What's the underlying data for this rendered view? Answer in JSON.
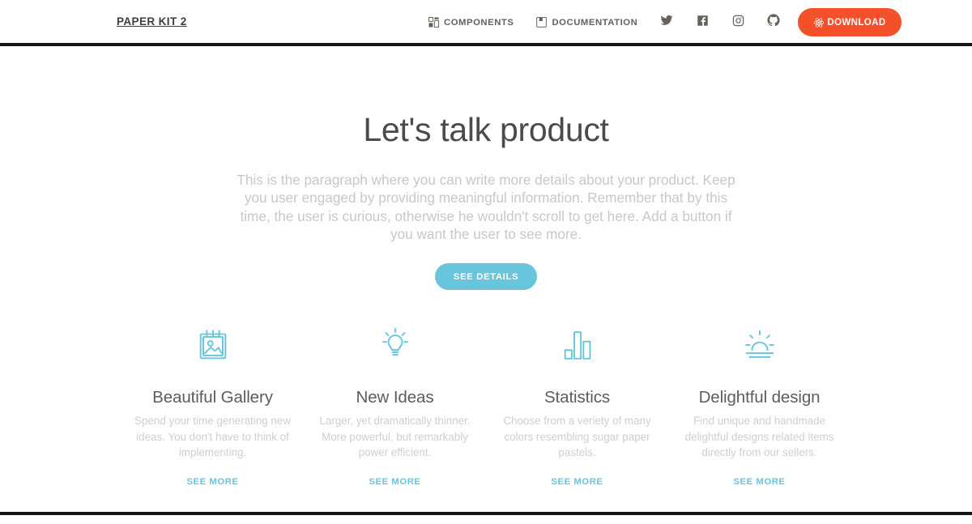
{
  "navbar": {
    "brand": "PAPER KIT 2",
    "links": [
      {
        "label": "COMPONENTS",
        "icon": "components-icon"
      },
      {
        "label": "DOCUMENTATION",
        "icon": "documentation-icon"
      }
    ],
    "socials": [
      {
        "name": "twitter-icon",
        "title": "Twitter"
      },
      {
        "name": "facebook-icon",
        "title": "Facebook"
      },
      {
        "name": "instagram-icon",
        "title": "Instagram"
      },
      {
        "name": "github-icon",
        "title": "GitHub"
      }
    ],
    "download_label": "DOWNLOAD",
    "download_icon": "react-logo-icon"
  },
  "hero": {
    "title": "Let's talk product",
    "paragraph": "This is the paragraph where you can write more details about your product. Keep you user engaged by providing meaningful information. Remember that by this time, the user is curious, otherwise he wouldn't scroll to get here. Add a button if you want the user to see more.",
    "cta_label": "SEE DETAILS"
  },
  "features": [
    {
      "icon": "gallery-album-icon",
      "title": "Beautiful Gallery",
      "description": "Spend your time generating new ideas. You don't have to think of implementing.",
      "link_label": "SEE MORE"
    },
    {
      "icon": "light-bulb-icon",
      "title": "New Ideas",
      "description": "Larger, yet dramatically thinner. More powerful, but remarkably power efficient.",
      "link_label": "SEE MORE"
    },
    {
      "icon": "bar-chart-icon",
      "title": "Statistics",
      "description": "Choose from a veriety of many colors resembling sugar paper pastels.",
      "link_label": "SEE MORE"
    },
    {
      "icon": "sunrise-icon",
      "title": "Delightful design",
      "description": "Find unique and handmade delightful designs related items directly from our sellers.",
      "link_label": "SEE MORE"
    }
  ],
  "colors": {
    "accent_blue": "#68c5dc",
    "download_red": "#f4502a",
    "heading_gray": "#4b4b4b",
    "muted_text": "#c8c8c8",
    "nav_text": "#66615b"
  }
}
